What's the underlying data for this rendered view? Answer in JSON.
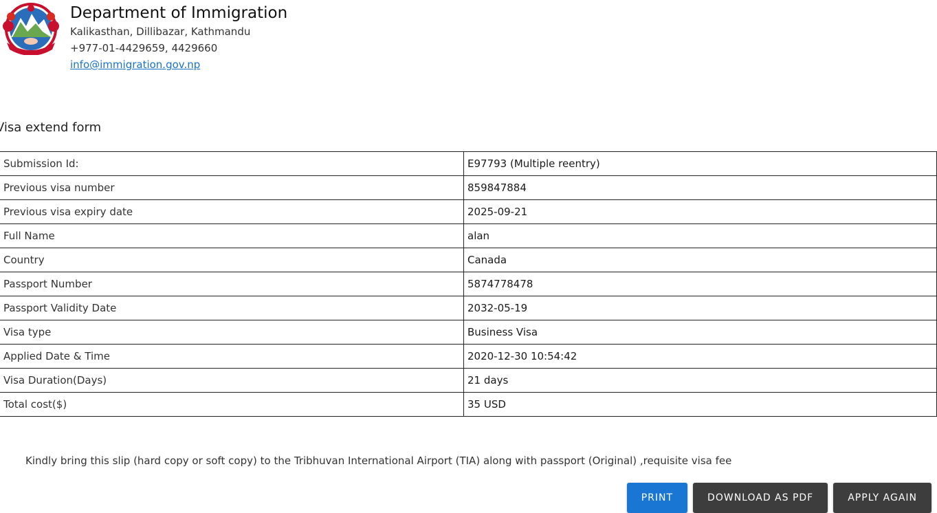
{
  "header": {
    "title": "Department of Immigration",
    "address": "Kalikasthan, Dillibazar, Kathmandu",
    "phone": "+977-01-4429659, 4429660",
    "email": "info@immigration.gov.np"
  },
  "form": {
    "title": "Visa extend form",
    "rows": [
      {
        "label": "Submission Id:",
        "value": "E97793 (Multiple reentry)"
      },
      {
        "label": "Previous visa number",
        "value": "859847884"
      },
      {
        "label": "Previous visa expiry date",
        "value": "2025-09-21"
      },
      {
        "label": "Full Name",
        "value": "alan"
      },
      {
        "label": "Country",
        "value": "Canada"
      },
      {
        "label": "Passport Number",
        "value": "5874778478"
      },
      {
        "label": "Passport Validity Date",
        "value": "2032-05-19"
      },
      {
        "label": "Visa type",
        "value": "Business Visa"
      },
      {
        "label": "Applied Date & Time",
        "value": "2020-12-30 10:54:42"
      },
      {
        "label": "Visa Duration(Days)",
        "value": "21 days"
      },
      {
        "label": "Total cost($)",
        "value": "35 USD"
      }
    ]
  },
  "note": "Kindly bring this slip (hard copy or soft copy) to the Tribhuvan International Airport (TIA) along with passport (Original) ,requisite visa fee",
  "actions": {
    "print_label": "PRINT",
    "download_label": "DOWNLOAD AS PDF",
    "apply_again_label": "APPLY AGAIN"
  },
  "colors": {
    "primary": "#1976d2",
    "dark_button": "#3d3d3d",
    "link": "#1a73c9"
  }
}
